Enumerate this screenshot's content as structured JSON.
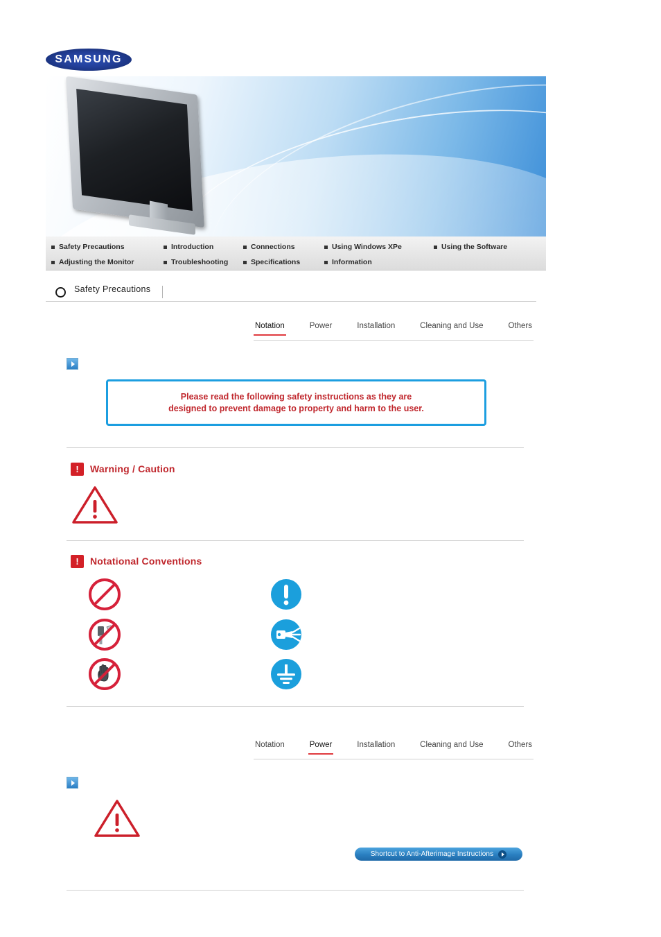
{
  "brand": {
    "logo_text": "SAMSUNG"
  },
  "nav": {
    "row1": [
      {
        "label": "Safety Precautions"
      },
      {
        "label": "Introduction"
      },
      {
        "label": "Connections"
      },
      {
        "label": "Using Windows XPe"
      },
      {
        "label": "Using the Software"
      }
    ],
    "row2": [
      {
        "label": "Adjusting the Monitor"
      },
      {
        "label": "Troubleshooting"
      },
      {
        "label": "Specifications"
      },
      {
        "label": "Information"
      }
    ]
  },
  "section": {
    "title": "Safety Precautions"
  },
  "tabs_top": {
    "items": [
      {
        "label": "Notation",
        "active": true
      },
      {
        "label": "Power",
        "active": false
      },
      {
        "label": "Installation",
        "active": false
      },
      {
        "label": "Cleaning and Use",
        "active": false
      },
      {
        "label": "Others",
        "active": false
      }
    ]
  },
  "tabs_bottom": {
    "items": [
      {
        "label": "Notation",
        "active": false
      },
      {
        "label": "Power",
        "active": true
      },
      {
        "label": "Installation",
        "active": false
      },
      {
        "label": "Cleaning and Use",
        "active": false
      },
      {
        "label": "Others",
        "active": false
      }
    ]
  },
  "notice": {
    "line1": "Please read the following safety instructions as they are",
    "line2": "designed to prevent damage to property and harm to the user."
  },
  "headings": {
    "warning_caution": "Warning / Caution",
    "notational_conventions": "Notational Conventions",
    "bang_glyph": "!"
  },
  "icons": {
    "prohibited": "prohibited-icon",
    "no-disassembly": "no-disassembly-icon",
    "do-not-touch": "do-not-touch-icon",
    "must-follow": "must-follow-icon",
    "unplug": "unplug-icon",
    "ground": "ground-icon",
    "warning-triangle": "warning-triangle-icon",
    "arrow-marker": "blue-arrow-icon"
  },
  "shortcut": {
    "label": "Shortcut to Anti-Afterimage Instructions"
  },
  "colors": {
    "accent_red": "#c0272d",
    "accent_blue": "#1c9ee0",
    "tab_underline": "#e03a3e",
    "bang_bg": "#d32027"
  }
}
